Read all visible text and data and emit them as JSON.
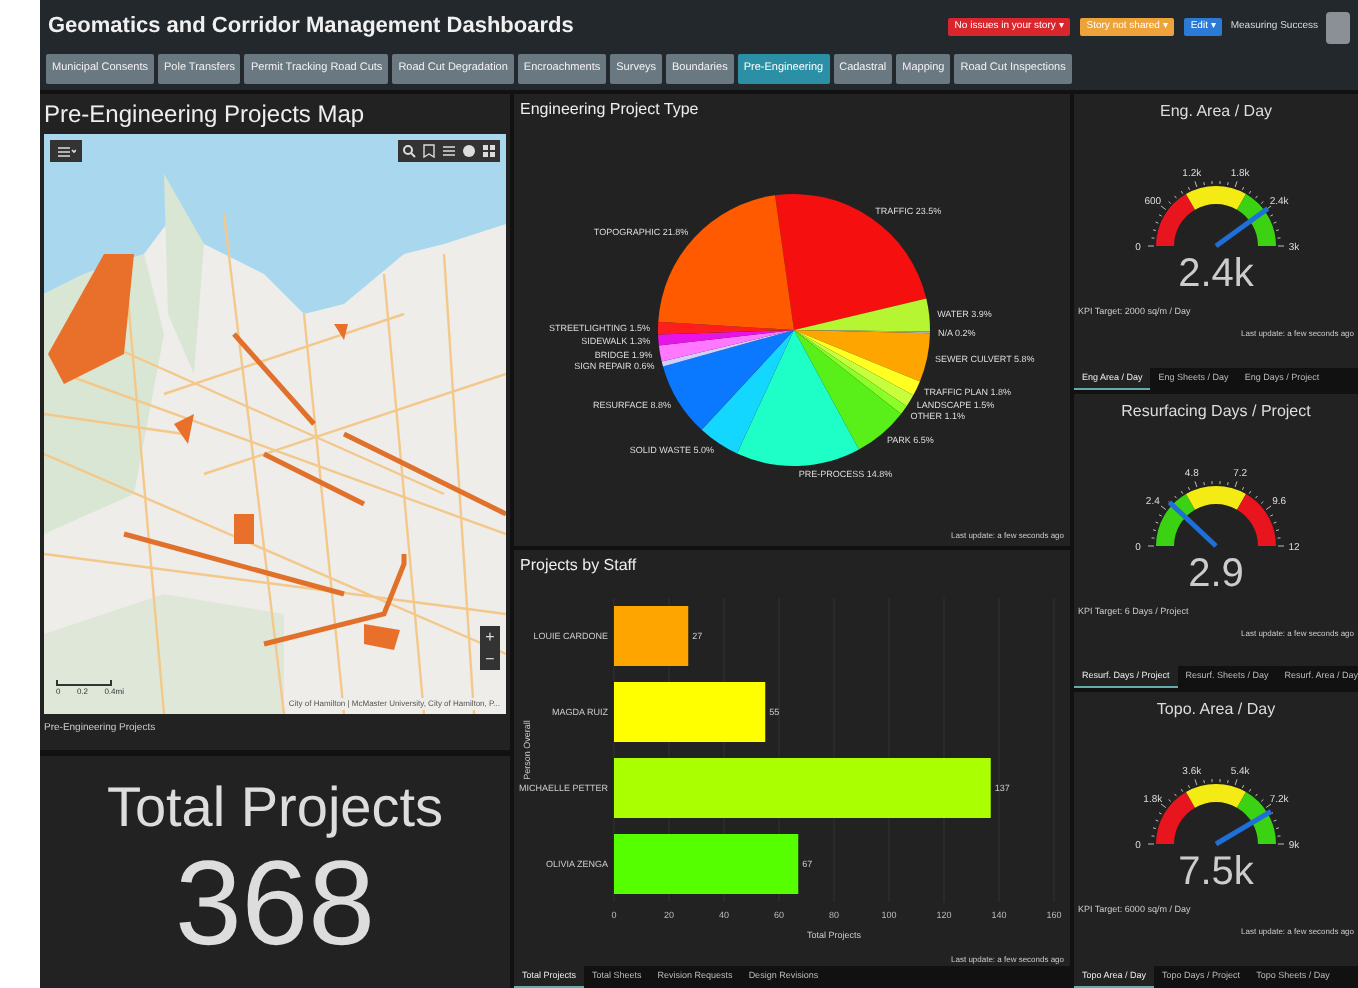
{
  "header": {
    "title": "Geomatics and Corridor Management Dashboards",
    "badges": [
      {
        "label": "No issues in your story ▾",
        "color": "#d8262c"
      },
      {
        "label": "Story not shared ▾",
        "color": "#eea23a"
      },
      {
        "label": "Edit ▾",
        "color": "#2b7bd6"
      }
    ],
    "user_label": "Measuring Success"
  },
  "tabs": [
    {
      "label": "Municipal Consents",
      "selected": false
    },
    {
      "label": "Pole Transfers",
      "selected": false
    },
    {
      "label": "Permit Tracking Road Cuts",
      "selected": false
    },
    {
      "label": "Road Cut Degradation",
      "selected": false
    },
    {
      "label": "Encroachments",
      "selected": false
    },
    {
      "label": "Surveys",
      "selected": false
    },
    {
      "label": "Boundaries",
      "selected": false
    },
    {
      "label": "Pre-Engineering",
      "selected": true
    },
    {
      "label": "Cadastral",
      "selected": false
    },
    {
      "label": "Mapping",
      "selected": false
    },
    {
      "label": "Road Cut Inspections",
      "selected": false
    }
  ],
  "map_panel": {
    "title": "Pre-Engineering Projects Map",
    "attribution": "City of Hamilton | McMaster University, City of Hamilton, P...",
    "scale_labels": [
      "0",
      "0.2",
      "0.4mi"
    ],
    "zoom_buttons": [
      "+",
      "−"
    ],
    "footer": "Pre-Engineering Projects"
  },
  "total_panel": {
    "label": "Total Projects",
    "value": "368"
  },
  "pie_panel": {
    "title": "Engineering Project Type",
    "last_update": "Last update: a few seconds ago",
    "chart_data": {
      "type": "pie",
      "categories": [
        "TRAFFIC 23.5%",
        "WATER 3.9%",
        "N/A 0.2%",
        "SEWER CULVERT 5.8%",
        "TRAFFIC PLAN 1.8%",
        "LANDSCAPE 1.5%",
        "OTHER 1.1%",
        "PARK 6.5%",
        "PRE-PROCESS 14.8%",
        "SOLID WASTE 5.0%",
        "RESURFACE 8.8%",
        "SIGN REPAIR 0.6%",
        "BRIDGE 1.9%",
        "SIDEWALK 1.3%",
        "STREETLIGHTING 1.5%",
        "TOPOGRAPHIC 21.8%"
      ],
      "series": [
        {
          "values": [
            23.5,
            3.9,
            0.2,
            5.8,
            1.8,
            1.5,
            1.1,
            6.5,
            14.8,
            5.0,
            8.8,
            0.6,
            1.9,
            1.3,
            1.5,
            21.8
          ],
          "colors": [
            "#f50f0f",
            "#b6f532",
            "#b0b0b0",
            "#ffa500",
            "#ffff22",
            "#c8ff3c",
            "#8cff28",
            "#58f018",
            "#1effc8",
            "#14d7ff",
            "#0a78ff",
            "#d0d0ff",
            "#ff78ff",
            "#e614e6",
            "#ff1e1e",
            "#ff5a00"
          ]
        }
      ]
    }
  },
  "bar_panel": {
    "title": "Projects by Staff",
    "last_update": "Last update: a few seconds ago",
    "chart_data": {
      "type": "bar",
      "orientation": "horizontal",
      "xlabel": "Total Projects",
      "ylabel": "Person Overall",
      "data_labels": true,
      "categories": [
        "LOUIE CARDONE",
        "MAGDA RUIZ",
        "MICHAELLE PETTER",
        "OLIVIA ZENGA"
      ],
      "grid": true,
      "series": [
        {
          "values": [
            27,
            55,
            137,
            67
          ],
          "colors": [
            "#ffa500",
            "#ffff00",
            "#aaff00",
            "#55ff00"
          ]
        }
      ],
      "xlim": [
        0,
        160
      ],
      "xticks": [
        0,
        20,
        40,
        60,
        80,
        100,
        120,
        140,
        160
      ]
    },
    "tabs": [
      {
        "label": "Total Projects",
        "selected": true
      },
      {
        "label": "Total Sheets",
        "selected": false
      },
      {
        "label": "Revision Requests",
        "selected": false
      },
      {
        "label": "Design Revisions",
        "selected": false
      }
    ]
  },
  "gauges": [
    {
      "title": "Eng. Area / Day",
      "value": "2.4k",
      "level": 0.8,
      "ticks": [
        "0",
        "600",
        "1.2k",
        "1.8k",
        "2.4k",
        "3k"
      ],
      "bands": [
        {
          "color": "#e8141e"
        },
        {
          "color": "#f5eb14"
        },
        {
          "color": "#3cd214"
        }
      ],
      "kpi": "KPI Target: 2000 sq/m / Day",
      "last_update": "Last update: a few seconds ago",
      "tabs": [
        {
          "label": "Eng Area / Day",
          "selected": true
        },
        {
          "label": "Eng Sheets / Day",
          "selected": false
        },
        {
          "label": "Eng Days / Project",
          "selected": false
        }
      ]
    },
    {
      "title": "Resurfacing Days / Project",
      "value": "2.9",
      "level": 0.24,
      "ticks": [
        "0",
        "2.4",
        "4.8",
        "7.2",
        "9.6",
        "12"
      ],
      "bands": [
        {
          "color": "#3cd214"
        },
        {
          "color": "#f5eb14"
        },
        {
          "color": "#e8141e"
        }
      ],
      "kpi": "KPI Target: 6 Days / Project",
      "last_update": "Last update: a few seconds ago",
      "tabs": [
        {
          "label": "Resurf. Days / Project",
          "selected": true
        },
        {
          "label": "Resurf. Sheets / Day",
          "selected": false
        },
        {
          "label": "Resurf. Area / Day",
          "selected": false
        }
      ]
    },
    {
      "title": "Topo. Area / Day",
      "value": "7.5k",
      "level": 0.83,
      "ticks": [
        "0",
        "1.8k",
        "3.6k",
        "5.4k",
        "7.2k",
        "9k"
      ],
      "bands": [
        {
          "color": "#e8141e"
        },
        {
          "color": "#f5eb14"
        },
        {
          "color": "#3cd214"
        }
      ],
      "kpi": "KPI Target: 6000 sq/m / Day",
      "last_update": "Last update: a few seconds ago",
      "tabs": [
        {
          "label": "Topo Area / Day",
          "selected": true
        },
        {
          "label": "Topo Days / Project",
          "selected": false
        },
        {
          "label": "Topo Sheets / Day",
          "selected": false
        }
      ]
    }
  ]
}
